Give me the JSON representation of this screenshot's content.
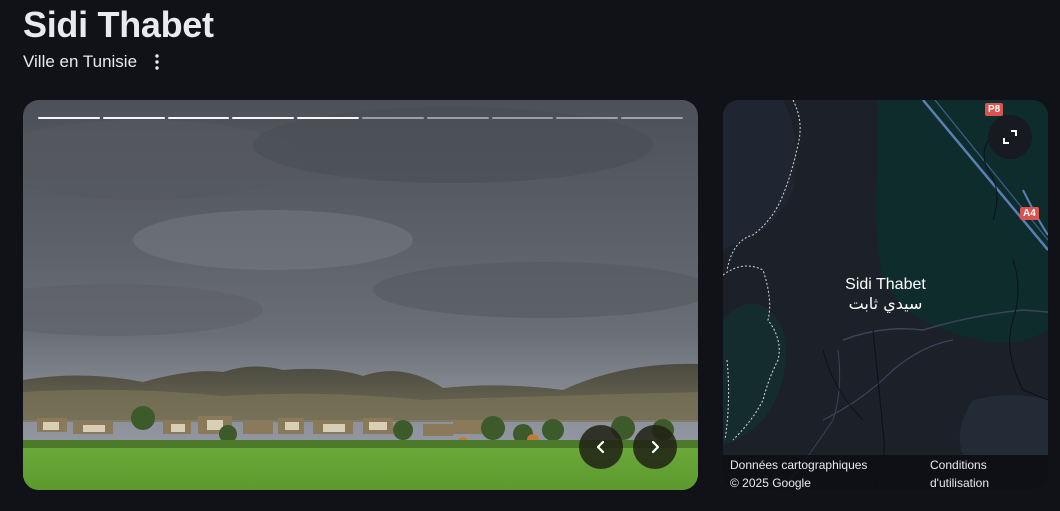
{
  "header": {
    "title": "Sidi Thabet",
    "subtitle": "Ville en Tunisie",
    "more_icon": "more-vert-icon"
  },
  "photo_carousel": {
    "segments_total": 10,
    "segments_viewed": 5,
    "prev_icon": "chevron-left-icon",
    "next_icon": "chevron-right-icon"
  },
  "map": {
    "expand_icon": "fullscreen-icon",
    "place_name": "Sidi Thabet",
    "place_name_arabic": "سيدي ثابت",
    "road_labels": [
      "P8",
      "A4"
    ],
    "attribution_line1": "Données cartographiques",
    "attribution_line2": "© 2025 Google",
    "terms_line1": "Conditions",
    "terms_line2": "d'utilisation"
  },
  "colors": {
    "background": "#101218",
    "map_land": "#1b2029",
    "map_green": "#0f2c2c",
    "road_badge": "#d9534f"
  }
}
